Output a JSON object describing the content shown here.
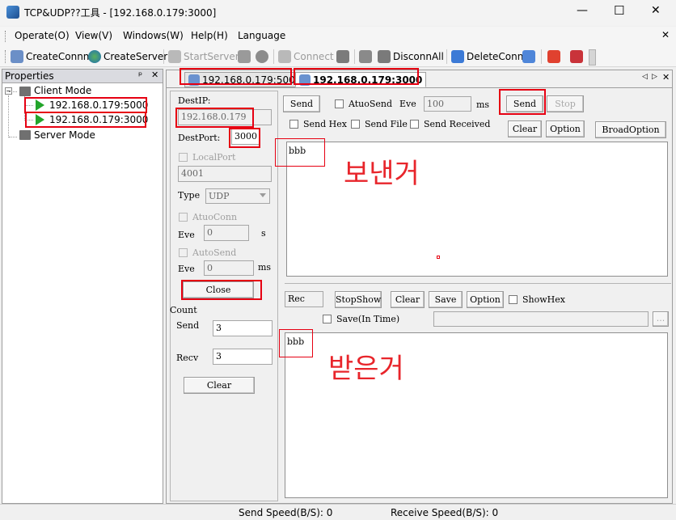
{
  "window": {
    "title": "TCP&UDP??工具 - [192.168.0.179:3000]",
    "minimize": "—",
    "maximize": "☐",
    "close": "✕"
  },
  "menu": [
    "Operate(O)",
    "View(V)",
    "Windows(W)",
    "Help(H)",
    "Language"
  ],
  "menu_close": "✕",
  "toolbar": {
    "create_conn": "CreateConnn",
    "create_server": "CreateServer",
    "start_server": "StartServer",
    "connect": "Connect",
    "disconn_all": "DisconnAll",
    "delete_conn": "DeleteConn"
  },
  "properties": {
    "title": "Properties",
    "pin": "ᵖ",
    "close": "✕",
    "client_mode": "Client Mode",
    "server_mode": "Server Mode",
    "connections": [
      "192.168.0.179:5000",
      "192.168.0.179:3000"
    ]
  },
  "tabs": [
    "192.168.0.179:5000",
    "192.168.0.179:3000"
  ],
  "tab_nav": {
    "left": "◁",
    "right": "▷",
    "close": "✕"
  },
  "left": {
    "dest_ip_label": "DestIP:",
    "dest_ip": "192.168.0.179",
    "dest_port_label": "DestPort:",
    "dest_port": "3000",
    "local_port_label": "LocalPort",
    "local_port": "4001",
    "type_label": "Type",
    "type_value": "UDP",
    "atuo_conn_label": "AtuoConn",
    "eve_label": "Eve",
    "eve_value": "0",
    "s_unit": "s",
    "auto_send_label": "AutoSend",
    "eve2_label": "Eve",
    "eve2_value": "0",
    "ms_unit": "ms",
    "close_btn": "Close",
    "count_label": "Count",
    "send_label": "Send",
    "send_count": "3",
    "recv_label": "Recv",
    "recv_count": "3",
    "clear_btn": "Clear"
  },
  "send_panel": {
    "send_btn": "Send",
    "atuo_send_label": "AtuoSend",
    "eve_label": "Eve",
    "eve_value": "100",
    "ms_unit": "ms",
    "send_btn2": "Send",
    "stop_btn": "Stop",
    "send_hex": "Send Hex",
    "send_file": "Send File",
    "send_received": "Send Received",
    "clear_btn": "Clear",
    "option_btn": "Option",
    "broad_option_btn": "BroadOption",
    "text": "bbb",
    "annotation": "보낸거"
  },
  "recv_panel": {
    "rec_label": "Rec",
    "stop_show": "StopShow",
    "clear_btn": "Clear",
    "save_btn": "Save",
    "option_btn": "Option",
    "show_hex": "ShowHex",
    "save_in_time": "Save(In Time)",
    "browse": "...",
    "text": "bbb",
    "annotation": "받은거"
  },
  "status": {
    "send_speed": "Send Speed(B/S): 0",
    "receive_speed": "Receive Speed(B/S): 0"
  }
}
